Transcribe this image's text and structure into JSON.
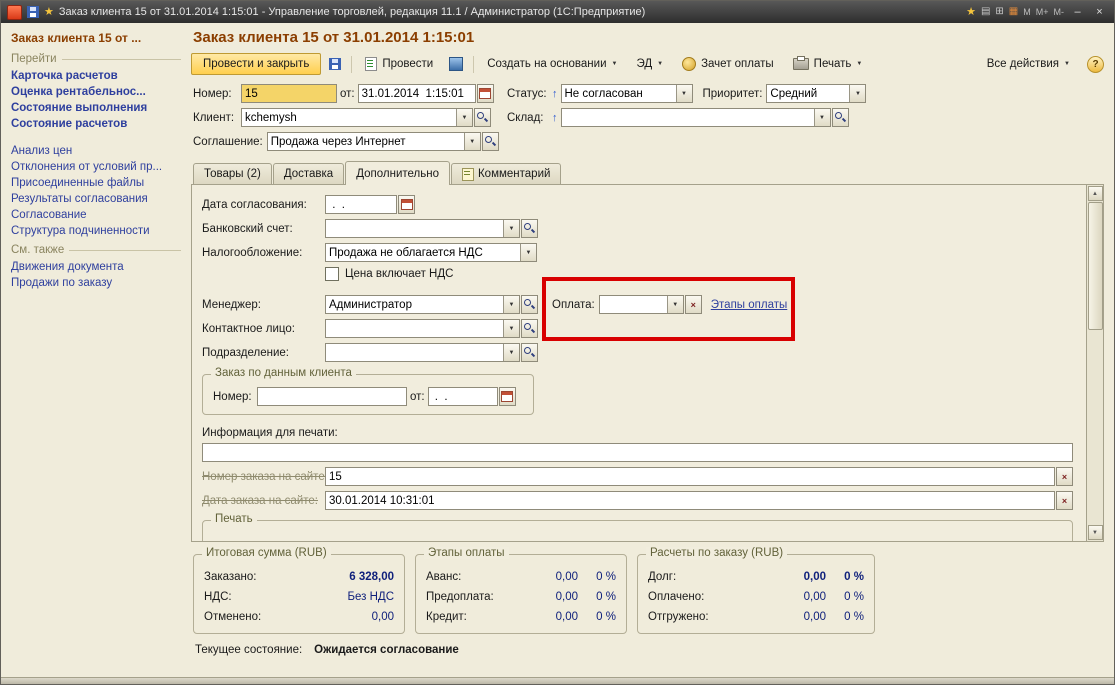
{
  "window_title": "Заказ клиента 15 от 31.01.2014 1:15:01 - Управление торговлей, редакция 11.1 / Администратор  (1С:Предприятие)",
  "icons": {
    "dropdown": "▼",
    "caret": "▼",
    "up": "↑",
    "scroll_up": "▲",
    "scroll_down": "▼",
    "clear": "×",
    "minimize": "–",
    "close": "×",
    "star": "★",
    "page": "▤",
    "grid": "⊞",
    "calendar": "▦",
    "m": "M",
    "m_plus": "M+",
    "m_minus": "M-",
    "help": "?"
  },
  "colors": {
    "accent_gold": "#ffcf4e",
    "title_brown": "#8b3e00",
    "link_blue": "#2e3f9e",
    "value_navy": "#10217c",
    "annotation_red": "#d80000",
    "window_bg": "#f0ecdb"
  },
  "sidebar": {
    "title": "Заказ клиента 15 от ...",
    "go_header": "Перейти",
    "go_bold": [
      "Карточка расчетов",
      "Оценка рентабельнос...",
      "Состояние выполнения",
      "Состояние расчетов"
    ],
    "go_links": [
      "Анализ цен",
      "Отклонения от условий пр...",
      "Присоединенные файлы",
      "Результаты согласования",
      "Согласование",
      "Структура подчиненности"
    ],
    "see_also_header": "См. также",
    "see_also_links": [
      "Движения документа",
      "Продажи по заказу"
    ]
  },
  "header": {
    "title": "Заказ клиента 15 от 31.01.2014 1:15:01"
  },
  "toolbar": {
    "post_close": "Провести и закрыть",
    "post": "Провести",
    "create_based": "Создать на основании",
    "ed": "ЭД",
    "payment_offset": "Зачет оплаты",
    "print": "Печать",
    "all_actions": "Все действия",
    "help": "?"
  },
  "fields": {
    "number_label": "Номер:",
    "number_value": "15",
    "date_label": "от:",
    "date_value": "31.01.2014  1:15:01",
    "status_label": "Статус:",
    "status_value": "Не согласован",
    "priority_label": "Приоритет:",
    "priority_value": "Средний",
    "client_label": "Клиент:",
    "client_value": "kchemysh",
    "warehouse_label": "Склад:",
    "warehouse_value": "",
    "agreement_label": "Соглашение:",
    "agreement_value": "Продажа через Интернет"
  },
  "tabs": [
    "Товары (2)",
    "Доставка",
    "Дополнительно",
    "Комментарий"
  ],
  "panel": {
    "approval_date_label": "Дата согласования:",
    "approval_date_value": " .  .",
    "bank_account_label": "Банковский счет:",
    "bank_account_value": "",
    "taxation_label": "Налогообложение:",
    "taxation_value": "Продажа не облагается НДС",
    "vat_checkbox_label": "Цена включает НДС",
    "manager_label": "Менеджер:",
    "manager_value": "Администратор",
    "payment_label": "Оплата:",
    "payment_value": "",
    "payment_stages_link": "Этапы оплаты",
    "contact_label": "Контактное лицо:",
    "contact_value": "",
    "department_label": "Подразделение:",
    "department_value": "",
    "client_order_group": "Заказ по данным клиента",
    "client_order_number_label": "Номер:",
    "client_order_number_value": "",
    "client_order_date_label": "от:",
    "client_order_date_value": " .  .",
    "print_info_label": "Информация для печати:",
    "print_info_value": "",
    "site_number_label": "Номер заказа на сайте:",
    "site_number_value": "15",
    "site_date_label": "Дата заказа на сайте:",
    "site_date_value": "30.01.2014 10:31:01",
    "print_group": "Печать"
  },
  "summary": {
    "total_group": "Итоговая сумма (RUB)",
    "total_rows": [
      {
        "label": "Заказано:",
        "value": "6 328,00"
      },
      {
        "label": "НДС:",
        "value": "Без НДС"
      },
      {
        "label": "Отменено:",
        "value": "0,00"
      }
    ],
    "stages_group": "Этапы оплаты",
    "stages_rows": [
      {
        "label": "Аванс:",
        "value": "0,00",
        "pct": "0 %"
      },
      {
        "label": "Предоплата:",
        "value": "0,00",
        "pct": "0 %"
      },
      {
        "label": "Кредит:",
        "value": "0,00",
        "pct": "0 %"
      }
    ],
    "calc_group": "Расчеты по заказу (RUB)",
    "calc_rows": [
      {
        "label": "Долг:",
        "value": "0,00",
        "pct": "0 %"
      },
      {
        "label": "Оплачено:",
        "value": "0,00",
        "pct": "0 %"
      },
      {
        "label": "Отгружено:",
        "value": "0,00",
        "pct": "0 %"
      }
    ]
  },
  "status": {
    "label": "Текущее состояние:",
    "value": "Ожидается согласование"
  }
}
